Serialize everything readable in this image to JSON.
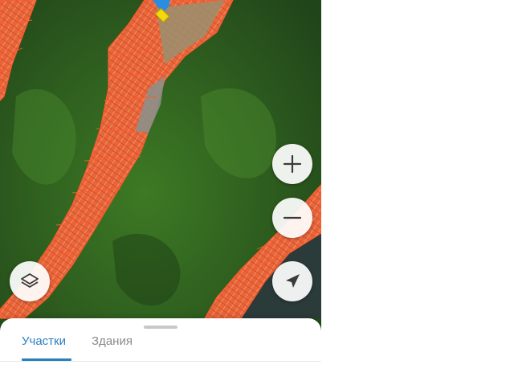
{
  "tabs": [
    {
      "label": "Участки",
      "active": true
    },
    {
      "label": "Здания",
      "active": false
    }
  ],
  "colors": {
    "accent": "#2a7fbf",
    "parcel_outline": "#ff5a2e",
    "marker": "#2a8de0",
    "marker_tag": "#f5d90a"
  },
  "icons": {
    "zoom_in": "plus-icon",
    "zoom_out": "minus-icon",
    "layers": "layers-icon",
    "locate": "navigation-arrow-icon",
    "marker": "map-pin-icon"
  }
}
